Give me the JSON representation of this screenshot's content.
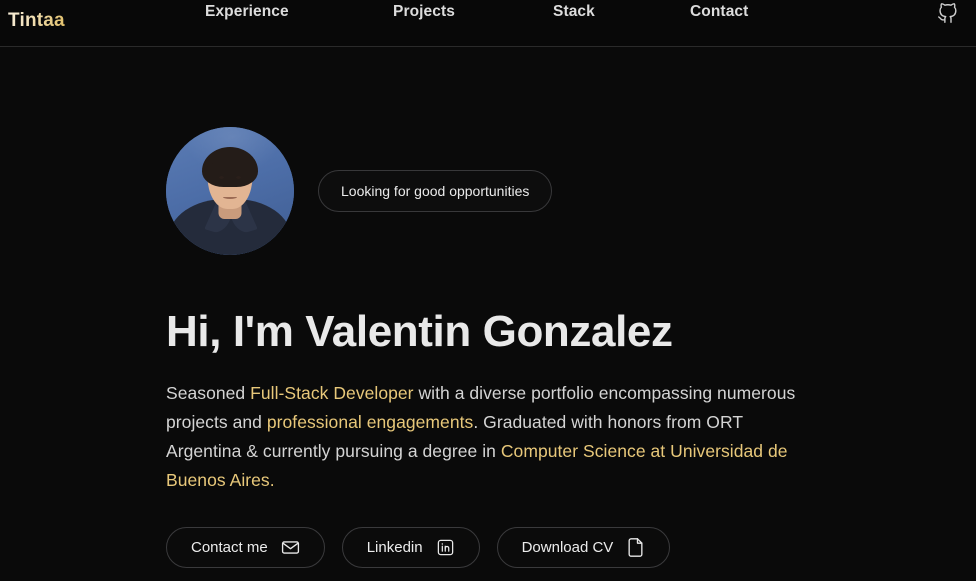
{
  "meta": {
    "background_color": "#0a0a0a",
    "accent_gold": "#e8c87a",
    "text_color": "#e6e6e6",
    "border_color": "#3a3a3c"
  },
  "navbar": {
    "brand": "Tintaa",
    "links": [
      {
        "label": "Experience",
        "name": "nav-link-experience"
      },
      {
        "label": "Projects",
        "name": "nav-link-projects"
      },
      {
        "label": "Stack",
        "name": "nav-link-stack"
      },
      {
        "label": "Contact",
        "name": "nav-link-contact"
      }
    ],
    "github_icon": "github-icon"
  },
  "hero": {
    "avatar_alt": "Portrait photo of Valentin Gonzalez on a blue background",
    "badge": "Looking for good opportunities",
    "headline": "Hi, I'm Valentin Gonzalez",
    "bio": {
      "part1": "Seasoned ",
      "hl1": "Full-Stack Developer",
      "part2": " with a diverse portfolio encompassing numerous projects and ",
      "hl2": "professional engagements",
      "part3": ". Graduated with honors from ORT Argentina & currently pursuing a degree in ",
      "hl3": "Computer Science at Universidad de Buenos Aires."
    },
    "buttons": [
      {
        "label": "Contact me",
        "icon": "mail-icon"
      },
      {
        "label": "Linkedin",
        "icon": "linkedin-icon"
      },
      {
        "label": "Download CV",
        "icon": "file-document-icon"
      }
    ]
  }
}
